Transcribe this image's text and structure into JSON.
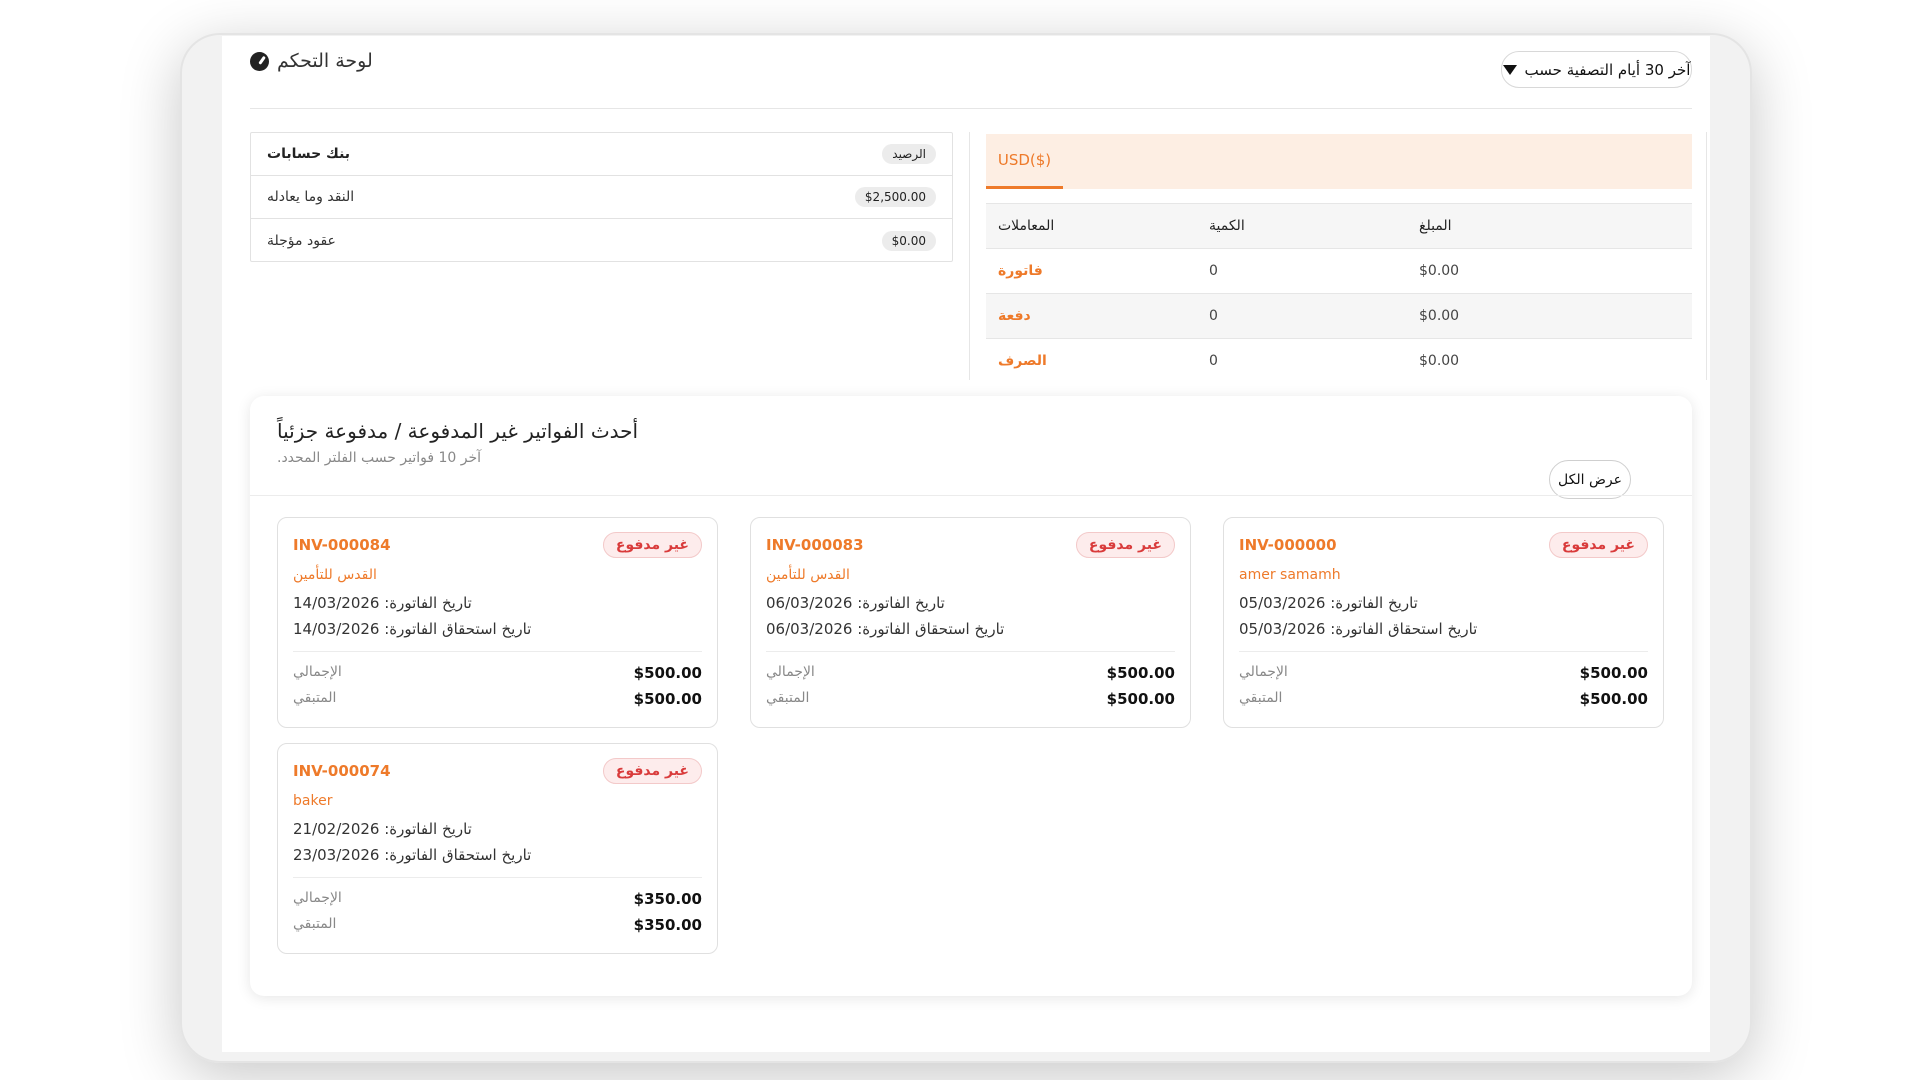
{
  "header": {
    "title": "لوحة التحكم",
    "filter_label": "آخر 30 أيام التصفية حسب"
  },
  "bank": {
    "header_label": "بنك حسابات",
    "header_badge": "الرصيد",
    "rows": [
      {
        "label": "النقد وما يعادله",
        "amount": "$2,500.00"
      },
      {
        "label": "عقود مؤجلة",
        "amount": "$0.00"
      }
    ]
  },
  "currency": {
    "tab_label": "USD($)",
    "columns": {
      "amount": "المبلغ",
      "quantity": "الكمية",
      "transactions": "المعاملات"
    },
    "rows": [
      {
        "name": "فاتورة",
        "quantity": "0",
        "amount": "$0.00"
      },
      {
        "name": "دفعة",
        "quantity": "0",
        "amount": "$0.00"
      },
      {
        "name": "الصرف",
        "quantity": "0",
        "amount": "$0.00"
      }
    ]
  },
  "invoices": {
    "title": "أحدث الفواتير غير المدفوعة / مدفوعة جزئياً",
    "subtitle": "آخر 10 فواتير حسب الفلتر المحدد.",
    "view_all_label": "عرض الكل",
    "total_label": "الإجمالي",
    "remaining_label": "المتبقي",
    "invoice_date_prefix": "تاريخ الفاتورة: ",
    "due_date_prefix": "تاريخ استحقاق الفاتورة: ",
    "items": [
      {
        "number": "INV-000084",
        "status": "غير مدفوع",
        "customer": "القدس للتأمين",
        "line1": "14/03/2026 :تاريخ الفاتورة",
        "line2": "14/03/2026 :تاريخ استحقاق الفاتورة",
        "total": "$500.00",
        "remaining": "$500.00"
      },
      {
        "number": "INV-000083",
        "status": "غير مدفوع",
        "customer": "القدس للتأمين",
        "line1": "06/03/2026 :تاريخ الفاتورة",
        "line2": "06/03/2026 :تاريخ استحقاق الفاتورة",
        "total": "$500.00",
        "remaining": "$500.00"
      },
      {
        "number": "INV-000000",
        "status": "غير مدفوع",
        "customer": "amer samamh",
        "line1": "05/03/2026 :تاريخ الفاتورة",
        "line2": "05/03/2026 :تاريخ استحقاق الفاتورة",
        "total": "$500.00",
        "remaining": "$500.00"
      },
      {
        "number": "INV-000074",
        "status": "غير مدفوع",
        "customer": "baker",
        "line1": "21/02/2026 :تاريخ الفاتورة",
        "line2": "23/03/2026 :تاريخ استحقاق الفاتورة",
        "total": "$350.00",
        "remaining": "$350.00"
      }
    ]
  },
  "colors": {
    "accent": "#ee7a2a",
    "badge_text": "#d93b3b",
    "badge_bg": "#fdecec",
    "tab_bar_bg": "#fdeee3"
  }
}
